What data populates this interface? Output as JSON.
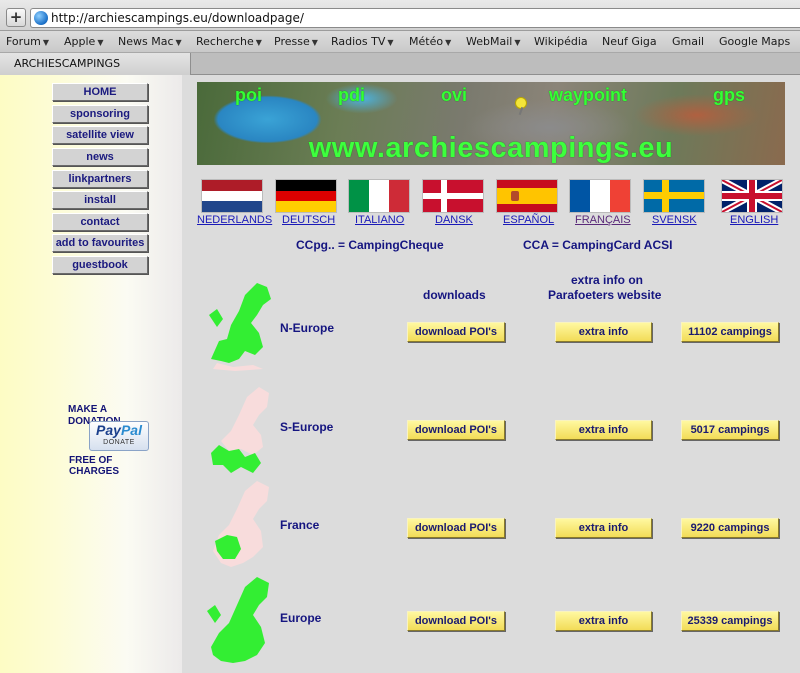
{
  "browser": {
    "new_tab": "+",
    "url": "http://archiescampings.eu/downloadpage/",
    "bookmarks": [
      {
        "label": "Forum",
        "menu": true
      },
      {
        "label": "Apple",
        "menu": true
      },
      {
        "label": "News Mac",
        "menu": true
      },
      {
        "label": "Recherche",
        "menu": true
      },
      {
        "label": "Presse",
        "menu": true
      },
      {
        "label": "Radios TV",
        "menu": true
      },
      {
        "label": "Météo",
        "menu": true
      },
      {
        "label": "WebMail",
        "menu": true
      },
      {
        "label": "Wikipédia",
        "menu": false
      },
      {
        "label": "Neuf Giga",
        "menu": false
      },
      {
        "label": "Gmail",
        "menu": false
      },
      {
        "label": "Google Maps",
        "menu": false
      }
    ],
    "tab_title": "ARCHIESCAMPINGS"
  },
  "nav": [
    "HOME",
    "sponsoring",
    "satellite view",
    "news",
    "linkpartners",
    "install",
    "contact",
    "add to favourites",
    "guestbook"
  ],
  "donation": {
    "line1": "MAKE A",
    "line2": "DONATION",
    "line3": "FREE OF",
    "line4": "CHARGES",
    "paypal_pay": "Pay",
    "paypal_pal": "Pal",
    "paypal_donate": "DONATE"
  },
  "banner": {
    "words": [
      "poi",
      "pdi",
      "ovi",
      "waypoint",
      "gps"
    ],
    "site": "www.archiescampings.eu"
  },
  "languages": [
    "NEDERLANDS",
    "DEUTSCH",
    "ITALIANO",
    "DANSK",
    "ESPAÑOL",
    "FRANÇAIS",
    "SVENSK",
    "ENGLISH"
  ],
  "legend": {
    "ccpg": "CCpg.. = CampingCheque",
    "cca": "CCA = CampingCard ACSI"
  },
  "columns": {
    "downloads": "downloads",
    "extra_line1": "extra info on",
    "extra_line2": "Parafoeters website"
  },
  "rows": [
    {
      "region": "N-Europe",
      "download": "download POI's",
      "extra": "extra info",
      "count": "11102 campings"
    },
    {
      "region": "S-Europe",
      "download": "download POI's",
      "extra": "extra info",
      "count": "5017 campings"
    },
    {
      "region": "France",
      "download": "download POI's",
      "extra": "extra info",
      "count": "9220 campings"
    },
    {
      "region": "Europe",
      "download": "download POI's",
      "extra": "extra info",
      "count": "25339 campings"
    }
  ],
  "colors": {
    "map_green": "#33ee33",
    "map_pink": "#f8dcdc",
    "nav_text": "#1b1a7f",
    "button_yellow": "#f6e46a",
    "banner_text": "#3dff3d"
  }
}
